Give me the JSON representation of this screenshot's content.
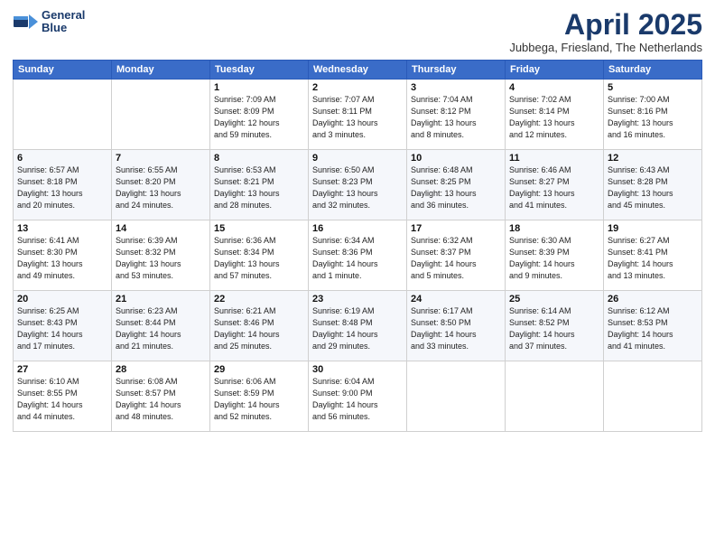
{
  "logo": {
    "line1": "General",
    "line2": "Blue"
  },
  "title": "April 2025",
  "subtitle": "Jubbega, Friesland, The Netherlands",
  "weekdays": [
    "Sunday",
    "Monday",
    "Tuesday",
    "Wednesday",
    "Thursday",
    "Friday",
    "Saturday"
  ],
  "weeks": [
    [
      {
        "day": "",
        "info": ""
      },
      {
        "day": "",
        "info": ""
      },
      {
        "day": "1",
        "info": "Sunrise: 7:09 AM\nSunset: 8:09 PM\nDaylight: 12 hours\nand 59 minutes."
      },
      {
        "day": "2",
        "info": "Sunrise: 7:07 AM\nSunset: 8:11 PM\nDaylight: 13 hours\nand 3 minutes."
      },
      {
        "day": "3",
        "info": "Sunrise: 7:04 AM\nSunset: 8:12 PM\nDaylight: 13 hours\nand 8 minutes."
      },
      {
        "day": "4",
        "info": "Sunrise: 7:02 AM\nSunset: 8:14 PM\nDaylight: 13 hours\nand 12 minutes."
      },
      {
        "day": "5",
        "info": "Sunrise: 7:00 AM\nSunset: 8:16 PM\nDaylight: 13 hours\nand 16 minutes."
      }
    ],
    [
      {
        "day": "6",
        "info": "Sunrise: 6:57 AM\nSunset: 8:18 PM\nDaylight: 13 hours\nand 20 minutes."
      },
      {
        "day": "7",
        "info": "Sunrise: 6:55 AM\nSunset: 8:20 PM\nDaylight: 13 hours\nand 24 minutes."
      },
      {
        "day": "8",
        "info": "Sunrise: 6:53 AM\nSunset: 8:21 PM\nDaylight: 13 hours\nand 28 minutes."
      },
      {
        "day": "9",
        "info": "Sunrise: 6:50 AM\nSunset: 8:23 PM\nDaylight: 13 hours\nand 32 minutes."
      },
      {
        "day": "10",
        "info": "Sunrise: 6:48 AM\nSunset: 8:25 PM\nDaylight: 13 hours\nand 36 minutes."
      },
      {
        "day": "11",
        "info": "Sunrise: 6:46 AM\nSunset: 8:27 PM\nDaylight: 13 hours\nand 41 minutes."
      },
      {
        "day": "12",
        "info": "Sunrise: 6:43 AM\nSunset: 8:28 PM\nDaylight: 13 hours\nand 45 minutes."
      }
    ],
    [
      {
        "day": "13",
        "info": "Sunrise: 6:41 AM\nSunset: 8:30 PM\nDaylight: 13 hours\nand 49 minutes."
      },
      {
        "day": "14",
        "info": "Sunrise: 6:39 AM\nSunset: 8:32 PM\nDaylight: 13 hours\nand 53 minutes."
      },
      {
        "day": "15",
        "info": "Sunrise: 6:36 AM\nSunset: 8:34 PM\nDaylight: 13 hours\nand 57 minutes."
      },
      {
        "day": "16",
        "info": "Sunrise: 6:34 AM\nSunset: 8:36 PM\nDaylight: 14 hours\nand 1 minute."
      },
      {
        "day": "17",
        "info": "Sunrise: 6:32 AM\nSunset: 8:37 PM\nDaylight: 14 hours\nand 5 minutes."
      },
      {
        "day": "18",
        "info": "Sunrise: 6:30 AM\nSunset: 8:39 PM\nDaylight: 14 hours\nand 9 minutes."
      },
      {
        "day": "19",
        "info": "Sunrise: 6:27 AM\nSunset: 8:41 PM\nDaylight: 14 hours\nand 13 minutes."
      }
    ],
    [
      {
        "day": "20",
        "info": "Sunrise: 6:25 AM\nSunset: 8:43 PM\nDaylight: 14 hours\nand 17 minutes."
      },
      {
        "day": "21",
        "info": "Sunrise: 6:23 AM\nSunset: 8:44 PM\nDaylight: 14 hours\nand 21 minutes."
      },
      {
        "day": "22",
        "info": "Sunrise: 6:21 AM\nSunset: 8:46 PM\nDaylight: 14 hours\nand 25 minutes."
      },
      {
        "day": "23",
        "info": "Sunrise: 6:19 AM\nSunset: 8:48 PM\nDaylight: 14 hours\nand 29 minutes."
      },
      {
        "day": "24",
        "info": "Sunrise: 6:17 AM\nSunset: 8:50 PM\nDaylight: 14 hours\nand 33 minutes."
      },
      {
        "day": "25",
        "info": "Sunrise: 6:14 AM\nSunset: 8:52 PM\nDaylight: 14 hours\nand 37 minutes."
      },
      {
        "day": "26",
        "info": "Sunrise: 6:12 AM\nSunset: 8:53 PM\nDaylight: 14 hours\nand 41 minutes."
      }
    ],
    [
      {
        "day": "27",
        "info": "Sunrise: 6:10 AM\nSunset: 8:55 PM\nDaylight: 14 hours\nand 44 minutes."
      },
      {
        "day": "28",
        "info": "Sunrise: 6:08 AM\nSunset: 8:57 PM\nDaylight: 14 hours\nand 48 minutes."
      },
      {
        "day": "29",
        "info": "Sunrise: 6:06 AM\nSunset: 8:59 PM\nDaylight: 14 hours\nand 52 minutes."
      },
      {
        "day": "30",
        "info": "Sunrise: 6:04 AM\nSunset: 9:00 PM\nDaylight: 14 hours\nand 56 minutes."
      },
      {
        "day": "",
        "info": ""
      },
      {
        "day": "",
        "info": ""
      },
      {
        "day": "",
        "info": ""
      }
    ]
  ]
}
